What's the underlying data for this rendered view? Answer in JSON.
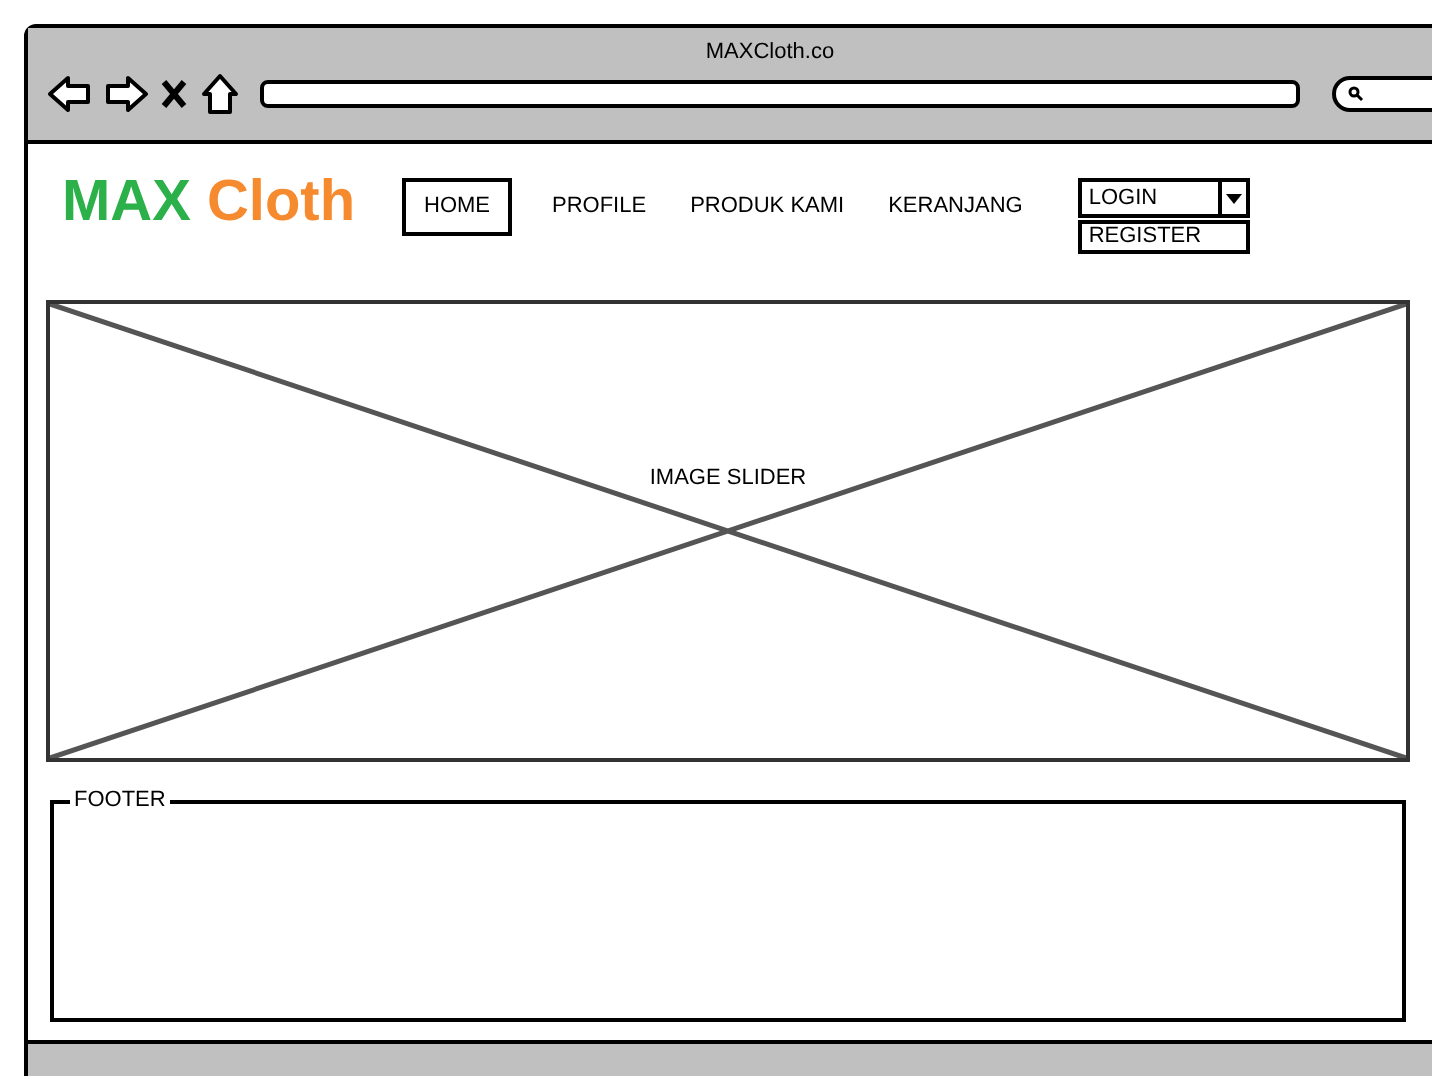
{
  "browser": {
    "title": "MAXCloth.co"
  },
  "logo": {
    "part_1": "MAX",
    "part_2": "Cloth"
  },
  "nav": [
    {
      "label": "HOME",
      "selected": true
    },
    {
      "label": "PROFILE",
      "selected": false
    },
    {
      "label": "PRODUK KAMI",
      "selected": false
    },
    {
      "label": "KERANJANG",
      "selected": false
    }
  ],
  "account_dropdown": {
    "value": "LOGIN",
    "expanded": true,
    "options": [
      "REGISTER"
    ]
  },
  "slider": {
    "label": "IMAGE SLIDER"
  },
  "footer": {
    "legend": "FOOTER"
  }
}
